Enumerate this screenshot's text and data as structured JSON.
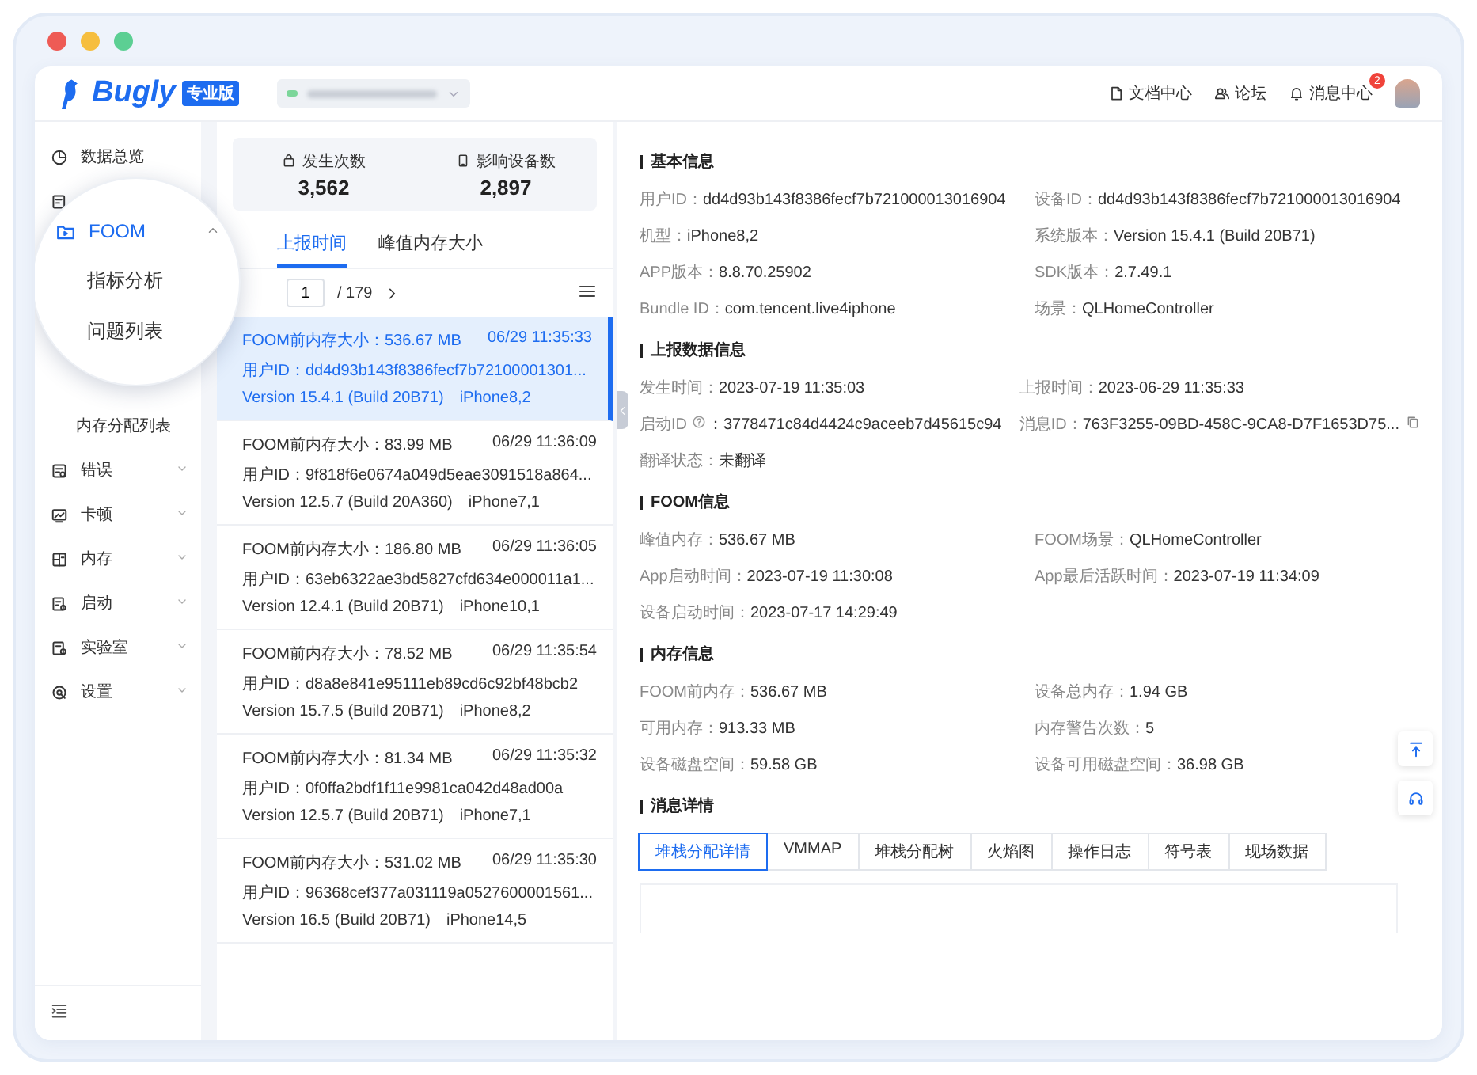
{
  "window": {
    "traffic_lights": [
      {
        "color": "#ee5b55"
      },
      {
        "color": "#f6be3f"
      },
      {
        "color": "#5ccf93"
      }
    ]
  },
  "header": {
    "logo": "Bugly",
    "edition": "专业版",
    "links": [
      {
        "label": "文档中心"
      },
      {
        "label": "论坛"
      },
      {
        "label": "消息中心",
        "badge": "2"
      }
    ]
  },
  "sidebar": {
    "top_item": {
      "label": "数据总览"
    },
    "magnifier": {
      "group": {
        "label": "FOOM",
        "expanded": true
      },
      "children": [
        {
          "label": "指标分析",
          "selected": false
        },
        {
          "label": "问题列表",
          "selected": false
        }
      ]
    },
    "sub_item": {
      "label": "内存分配列表",
      "selected": false
    },
    "groups": [
      {
        "label": "错误",
        "expanded": false
      },
      {
        "label": "卡顿",
        "expanded": false
      },
      {
        "label": "内存",
        "expanded": false
      },
      {
        "label": "启动",
        "expanded": false
      },
      {
        "label": "实验室",
        "expanded": false
      },
      {
        "label": "设置",
        "expanded": false
      }
    ]
  },
  "stats": [
    {
      "label": "发生次数",
      "value": "3,562"
    },
    {
      "label": "影响设备数",
      "value": "2,897"
    }
  ],
  "list_tabs": [
    {
      "label": "上报时间",
      "selected": true
    },
    {
      "label": "峰值内存大小",
      "selected": false
    }
  ],
  "pager": {
    "page": "1",
    "total": "/ 179"
  },
  "reports": [
    {
      "size": "FOOM前内存大小：536.67 MB",
      "time": "06/29 11:35:33",
      "user": "用户ID：dd4d93b143f8386fecf7b72100001301...",
      "version": "Version 15.4.1 (Build 20B71)",
      "device": "iPhone8,2",
      "selected": true
    },
    {
      "size": "FOOM前内存大小：83.99 MB",
      "time": "06/29 11:36:09",
      "user": "用户ID：9f818f6e0674a049d5eae3091518a864...",
      "version": "Version 12.5.7 (Build 20A360)",
      "device": "iPhone7,1",
      "selected": false
    },
    {
      "size": "FOOM前内存大小：186.80 MB",
      "time": "06/29 11:36:05",
      "user": "用户ID：63eb6322ae3bd5827cfd634e000011a1...",
      "version": "Version 12.4.1 (Build 20B71)",
      "device": "iPhone10,1",
      "selected": false
    },
    {
      "size": "FOOM前内存大小：78.52 MB",
      "time": "06/29 11:35:54",
      "user": "用户ID：d8a8e841e95111eb89cd6c92bf48bcb2",
      "version": "Version 15.7.5 (Build 20B71)",
      "device": "iPhone8,2",
      "selected": false
    },
    {
      "size": "FOOM前内存大小：81.34 MB",
      "time": "06/29 11:35:32",
      "user": "用户ID：0f0ffa2bdf1f11e9981ca042d48ad00a",
      "version": "Version 12.5.7 (Build 20B71)",
      "device": "iPhone7,1",
      "selected": false
    },
    {
      "size": "FOOM前内存大小：531.02 MB",
      "time": "06/29 11:35:30",
      "user": "用户ID：96368cef377a031119a0527600001561...",
      "version": "Version 16.5 (Build 20B71)",
      "device": "iPhone14,5",
      "selected": false
    }
  ],
  "sections": [
    {
      "title": "基本信息",
      "fields": [
        {
          "label": "用户ID：",
          "value": "dd4d93b143f8386fecf7b721000013016904",
          "kind": "text"
        },
        {
          "label": "设备ID：",
          "value": "dd4d93b143f8386fecf7b721000013016904",
          "kind": "text"
        },
        {
          "label": "机型：",
          "value": "iPhone8,2",
          "kind": "text"
        },
        {
          "label": "系统版本：",
          "value": "Version 15.4.1 (Build 20B71)",
          "kind": "text"
        },
        {
          "label": "APP版本：",
          "value": "8.8.70.25902",
          "kind": "text"
        },
        {
          "label": "SDK版本：",
          "value": "2.7.49.1",
          "kind": "text"
        },
        {
          "label": "Bundle ID：",
          "value": "com.tencent.live4iphone",
          "kind": "text"
        },
        {
          "label": "场景：",
          "value": "QLHomeController",
          "kind": "text"
        }
      ]
    },
    {
      "title": "上报数据信息",
      "fields": [
        {
          "label": "发生时间：",
          "value": "2023-07-19 11:35:03",
          "kind": "text"
        },
        {
          "label": "上报时间：",
          "value": "2023-06-29 11:35:33",
          "kind": "text"
        },
        {
          "label": "启动ID",
          "value": "：3778471c84d4424c9aceeb7d45615c94",
          "kind": "help"
        },
        {
          "label": "消息ID：",
          "value": "763F3255-09BD-458C-9CA8-D7F1653D75...",
          "kind": "copy"
        },
        {
          "label": "翻译状态：",
          "value": "未翻译",
          "kind": "text"
        }
      ]
    },
    {
      "title": "FOOM信息",
      "fields": [
        {
          "label": "峰值内存：",
          "value": "536.67 MB",
          "kind": "text"
        },
        {
          "label": "FOOM场景：",
          "value": "QLHomeController",
          "kind": "text"
        },
        {
          "label": "App启动时间：",
          "value": "2023-07-19 11:30:08",
          "kind": "text"
        },
        {
          "label": "App最后活跃时间：",
          "value": "2023-07-19 11:34:09",
          "kind": "text"
        },
        {
          "label": "设备启动时间：",
          "value": "2023-07-17 14:29:49",
          "kind": "text"
        }
      ]
    },
    {
      "title": "内存信息",
      "fields": [
        {
          "label": "FOOM前内存：",
          "value": "536.67 MB",
          "kind": "text"
        },
        {
          "label": "设备总内存：",
          "value": "1.94 GB",
          "kind": "text"
        },
        {
          "label": "可用内存：",
          "value": "913.33 MB",
          "kind": "text"
        },
        {
          "label": "内存警告次数：",
          "value": "5",
          "kind": "text"
        },
        {
          "label": "设备磁盘空间：",
          "value": "59.58 GB",
          "kind": "text"
        },
        {
          "label": "设备可用磁盘空间：",
          "value": "36.98 GB",
          "kind": "text"
        }
      ]
    }
  ],
  "message": {
    "title": "消息详情",
    "tabs": [
      {
        "label": "堆栈分配详情",
        "selected": true
      },
      {
        "label": "VMMAP",
        "selected": false
      },
      {
        "label": "堆栈分配树",
        "selected": false
      },
      {
        "label": "火焰图",
        "selected": false
      },
      {
        "label": "操作日志",
        "selected": false
      },
      {
        "label": "符号表",
        "selected": false
      },
      {
        "label": "现场数据",
        "selected": false
      }
    ]
  }
}
